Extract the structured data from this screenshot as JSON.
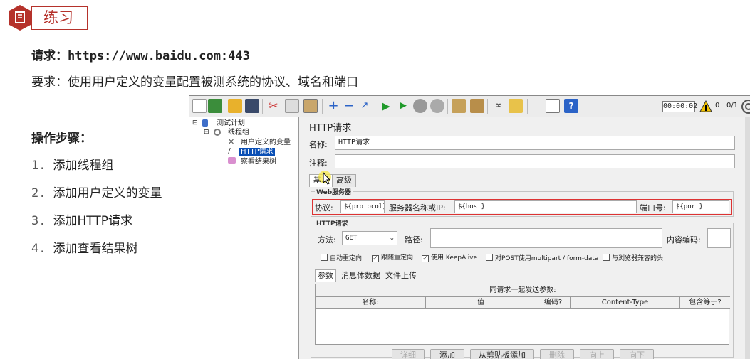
{
  "slide": {
    "title": "练习",
    "request_label": "请求：",
    "request_url": "https://www.baidu.com:443",
    "requirement": "要求：使用用户定义的变量配置被测系统的协议、域名和端口",
    "steps_title": "操作步骤：",
    "steps": [
      {
        "num": "1.",
        "text": "添加线程组"
      },
      {
        "num": "2.",
        "text": "添加用户定义的变量"
      },
      {
        "num": "3.",
        "text": "添加HTTP请求"
      },
      {
        "num": "4.",
        "text": "添加查看结果树"
      }
    ]
  },
  "toolbar": {
    "timer": "00:00:02",
    "warn_count": "0",
    "ratio": "0/1",
    "icons": [
      "new-icon",
      "templates-icon",
      "open-icon",
      "save-icon",
      "cut-icon",
      "copy-icon",
      "paste-icon",
      "expand-icon",
      "collapse-icon",
      "toggle-icon",
      "start-icon",
      "start-no-pause-icon",
      "stop-icon",
      "shutdown-icon",
      "clear-icon",
      "clear-all-icon",
      "search-icon",
      "reset-search-icon",
      "function-helper-icon",
      "help-icon"
    ]
  },
  "tree": {
    "root": "测试计划",
    "thread_group": "线程组",
    "user_vars": "用户定义的变量",
    "http_request": "HTTP请求",
    "result_tree": "察看结果树"
  },
  "panel": {
    "title": "HTTP请求",
    "name_label": "名称:",
    "name_value": "HTTP请求",
    "comment_label": "注释:",
    "tabs": [
      "基本",
      "高级"
    ],
    "web_server_title": "Web服务器",
    "protocol_label": "协议:",
    "protocol_value": "${protocol}",
    "server_label": "服务器名称或IP:",
    "server_value": "${host}",
    "port_label": "端口号:",
    "port_value": "${port}",
    "http_title": "HTTP请求",
    "method_label": "方法:",
    "method_value": "GET",
    "path_label": "路径:",
    "path_value": "",
    "encoding_label": "内容编码:",
    "checkboxes": [
      {
        "label": "自动重定向",
        "checked": false
      },
      {
        "label": "跟随重定向",
        "checked": true
      },
      {
        "label": "使用 KeepAlive",
        "checked": true
      },
      {
        "label": "对POST使用multipart / form-data",
        "checked": false
      },
      {
        "label": "与浏览器兼容的头",
        "checked": false
      }
    ],
    "subtabs": [
      "参数",
      "消息体数据",
      "文件上传"
    ],
    "table_caption": "同请求一起发送参数:",
    "columns": [
      "名称:",
      "值",
      "编码?",
      "Content-Type",
      "包含等于?"
    ],
    "buttons": [
      {
        "label": "详细",
        "enabled": false
      },
      {
        "label": "添加",
        "enabled": true
      },
      {
        "label": "从剪贴板添加",
        "enabled": true
      },
      {
        "label": "删除",
        "enabled": false
      },
      {
        "label": "向上",
        "enabled": false
      },
      {
        "label": "向下",
        "enabled": false
      }
    ]
  },
  "colors": {
    "brand_red": "#b5322b",
    "highlight_red": "#dd3333",
    "selection_blue": "#0a4fb5"
  }
}
